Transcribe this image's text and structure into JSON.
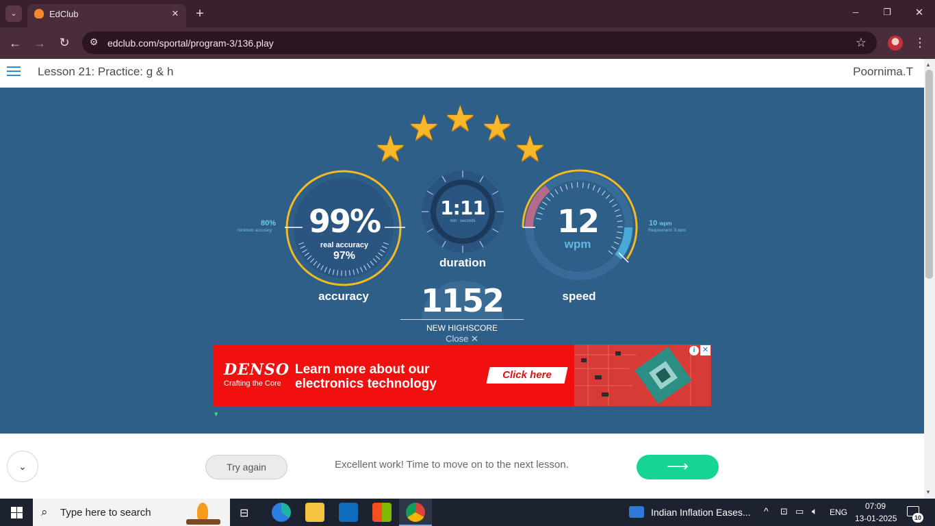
{
  "browser": {
    "tab_title": "EdClub",
    "tab_close": "✕",
    "new_tab": "+",
    "url": "edclub.com/sportal/program-3/136.play",
    "win_minimize": "─",
    "win_restore": "❐",
    "win_close": "✕"
  },
  "header": {
    "lesson_title": "Lesson 21: Practice: g & h",
    "user_name": "Poornima.T"
  },
  "results": {
    "stars": 5,
    "accuracy": {
      "value": "99%",
      "real_label": "real accuracy",
      "real_value": "97%",
      "label": "accuracy",
      "min_value": "80%",
      "min_label": "minimum accuracy",
      "fraction": 0.99
    },
    "duration": {
      "value": "1:11",
      "unit": "min : seconds",
      "label": "duration"
    },
    "speed": {
      "value": "12",
      "unit": "wpm",
      "label": "speed",
      "req_value": "10",
      "req_unit": "wpm",
      "req_label": "Requirement: 3 wpm"
    },
    "score": {
      "value": "1152",
      "label": "NEW HIGHSCORE",
      "close": "Close"
    }
  },
  "ad": {
    "brand": "DENSO",
    "tagline": "Crafting the Core",
    "headline": "Learn more about our electronics technology",
    "cta": "Click here"
  },
  "footer": {
    "try_again": "Try again",
    "message": "Excellent work! Time to move on to the next lesson.",
    "next_arrow": "⟶"
  },
  "taskbar": {
    "search_placeholder": "Type here to search",
    "news": "Indian Inflation Eases...",
    "language": "ENG",
    "time": "07:09",
    "date": "13-01-2025",
    "notifications": "10"
  },
  "colors": {
    "page_bg": "#2e5f89",
    "gauge_gold": "#f5b921",
    "gauge_track": "#2a4d74",
    "next_button": "#16d594",
    "ad_red": "#f0100f"
  }
}
